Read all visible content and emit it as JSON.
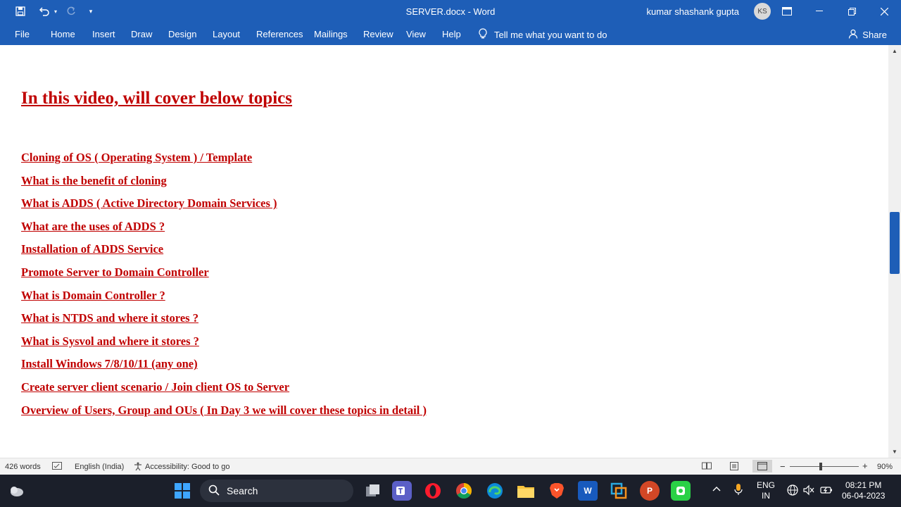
{
  "titlebar": {
    "doc_title": "SERVER.docx  -  Word",
    "user_name": "kumar shashank gupta",
    "avatar_initials": "KS"
  },
  "ribbon": {
    "tabs": [
      "File",
      "Home",
      "Insert",
      "Draw",
      "Design",
      "Layout",
      "References",
      "Mailings",
      "Review",
      "View",
      "Help"
    ],
    "tell_me": "Tell me what you want to do",
    "share": "Share"
  },
  "document": {
    "heading": "In this video, will cover below topics",
    "topics": [
      "Cloning of OS ( Operating System ) / Template",
      "What is the benefit of cloning",
      "What is ADDS ( Active Directory Domain Services )",
      "What are the uses of ADDS ?",
      "Installation of ADDS Service",
      "Promote Server to Domain Controller",
      "What is Domain Controller ?",
      "What is NTDS and where it stores ?",
      "What is Sysvol and where it stores ?",
      "Install Windows 7/8/10/11 (any one)",
      "Create server client scenario / Join client OS to Server",
      "Overview of Users, Group and OUs ( In Day 3 we will cover these topics in detail )"
    ]
  },
  "statusbar": {
    "word_count": "426 words",
    "language": "English (India)",
    "accessibility": "Accessibility: Good to go",
    "zoom": "90%"
  },
  "taskbar": {
    "search": "Search",
    "lang_top": "ENG",
    "lang_bottom": "IN",
    "time": "08:21 PM",
    "date": "06-04-2023"
  },
  "colors": {
    "word_blue": "#1e5eb7",
    "topic_red": "#c00000"
  }
}
